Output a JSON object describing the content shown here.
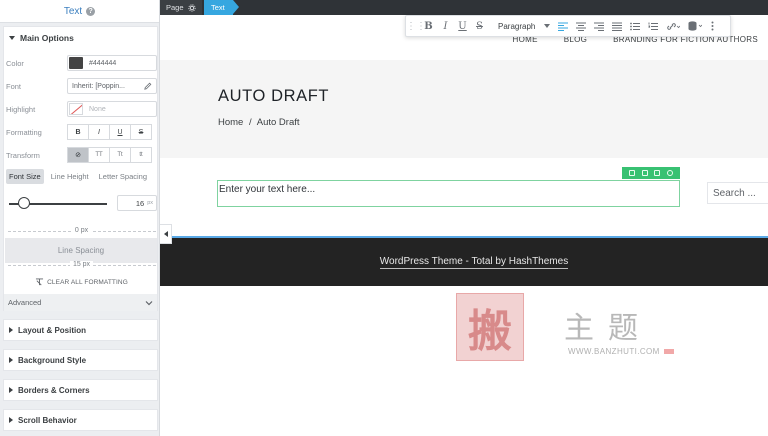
{
  "panel": {
    "header_title": "Text",
    "help_glyph": "?",
    "main_options": {
      "title": "Main Options",
      "color": {
        "label": "Color",
        "value": "#444444",
        "swatch": "#444444"
      },
      "font": {
        "label": "Font",
        "value": "Inherit: [Poppin..."
      },
      "highlight": {
        "label": "Highlight",
        "value": "None"
      },
      "formatting": {
        "label": "Formatting",
        "buttons": [
          "B",
          "I",
          "U",
          "S"
        ]
      },
      "transform": {
        "label": "Transform",
        "buttons": [
          "⊘",
          "TT",
          "Tt",
          "tt"
        ],
        "selected": 0
      },
      "tabs": [
        "Font Size",
        "Line Height",
        "Letter Spacing"
      ],
      "active_tab": "Font Size",
      "font_size": {
        "value": "16",
        "unit": "px"
      },
      "line_spacing_top": "0 px",
      "line_spacing_label": "Line Spacing",
      "line_spacing_bottom": "15 px",
      "clear_formatting": "CLEAR ALL FORMATTING",
      "advanced": "Advanced"
    },
    "sections": [
      "Layout & Position",
      "Background Style",
      "Borders & Corners",
      "Scroll Behavior"
    ]
  },
  "canvas": {
    "breadcrumb": {
      "page": "Page",
      "current": "Text"
    },
    "nav": [
      "HOME",
      "BLOG",
      "BRANDING FOR FICTION AUTHORS"
    ],
    "toolbar": {
      "buttons": [
        "B",
        "I",
        "U",
        "S"
      ],
      "block_format": "Paragraph"
    },
    "hero": {
      "title": "AUTO DRAFT",
      "crumb_home": "Home",
      "crumb_sep": "/",
      "crumb_current": "Auto Draft"
    },
    "text_placeholder": "Enter your text here...",
    "search_placeholder": "Search ...",
    "footer": "WordPress Theme - Total by HashThemes",
    "colors": {
      "accent": "#36a7e0",
      "element_tools": "#38c172",
      "footer_bg": "#232323",
      "footer_line": "#5aa9e6"
    }
  },
  "watermark": {
    "logo_glyph": "搬",
    "text": "主题",
    "url": "WWW.BANZHUTI.COM"
  }
}
